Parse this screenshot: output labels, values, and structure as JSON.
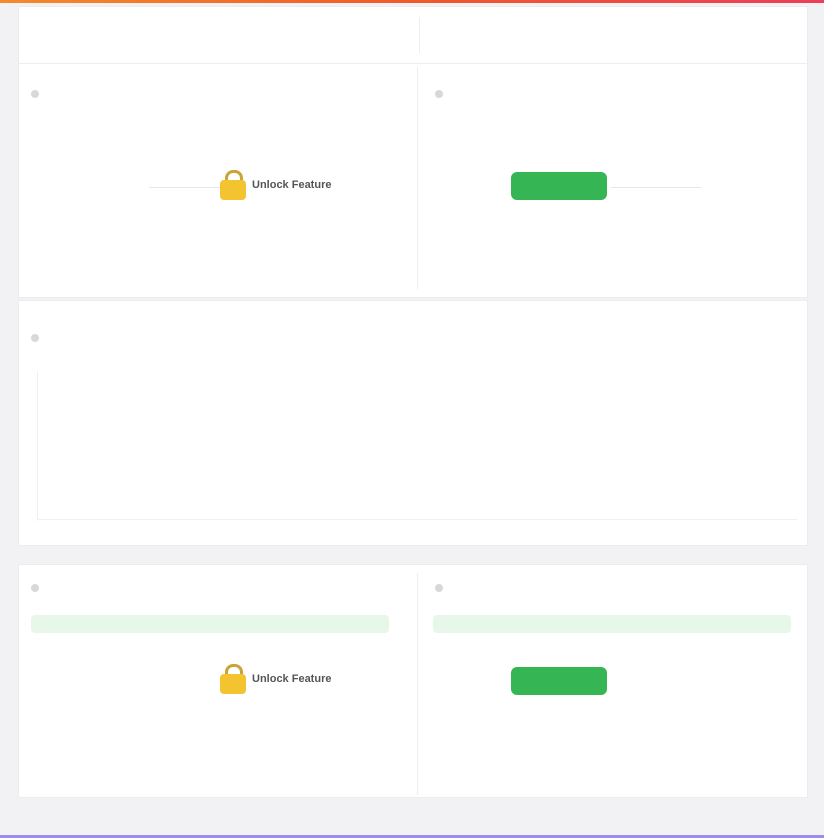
{
  "header": {
    "filter_text": "",
    "metric_tabs": [
      "",
      "",
      "",
      "",
      "",
      "",
      ""
    ]
  },
  "top_left_panel": {
    "title": "",
    "tick_label": ""
  },
  "top_right_panel": {
    "title": "",
    "tick_label": ""
  },
  "upsell_top": {
    "title": "Unlock Feature",
    "description": "",
    "button_label": ""
  },
  "wide_chart": {
    "title": "",
    "x_ticks": [
      "",
      "",
      "",
      "",
      "",
      "",
      "",
      "",
      "",
      "",
      "",
      "",
      "",
      "",
      "",
      "",
      "",
      "",
      "",
      "",
      "",
      "",
      "",
      "",
      "",
      "",
      "",
      "",
      "",
      "",
      ""
    ]
  },
  "bottom_left_panel": {
    "title": "",
    "footer_text": ""
  },
  "bottom_right_panel": {
    "title": "",
    "footer_text": ""
  },
  "upsell_bottom": {
    "title": "Unlock Feature",
    "description": "",
    "button_label": ""
  },
  "colors": {
    "accent_top": "#ef5a2a",
    "upgrade_green": "#35b553",
    "lock_gold": "#f4c430",
    "bottom_accent": "#9b8cf0"
  }
}
